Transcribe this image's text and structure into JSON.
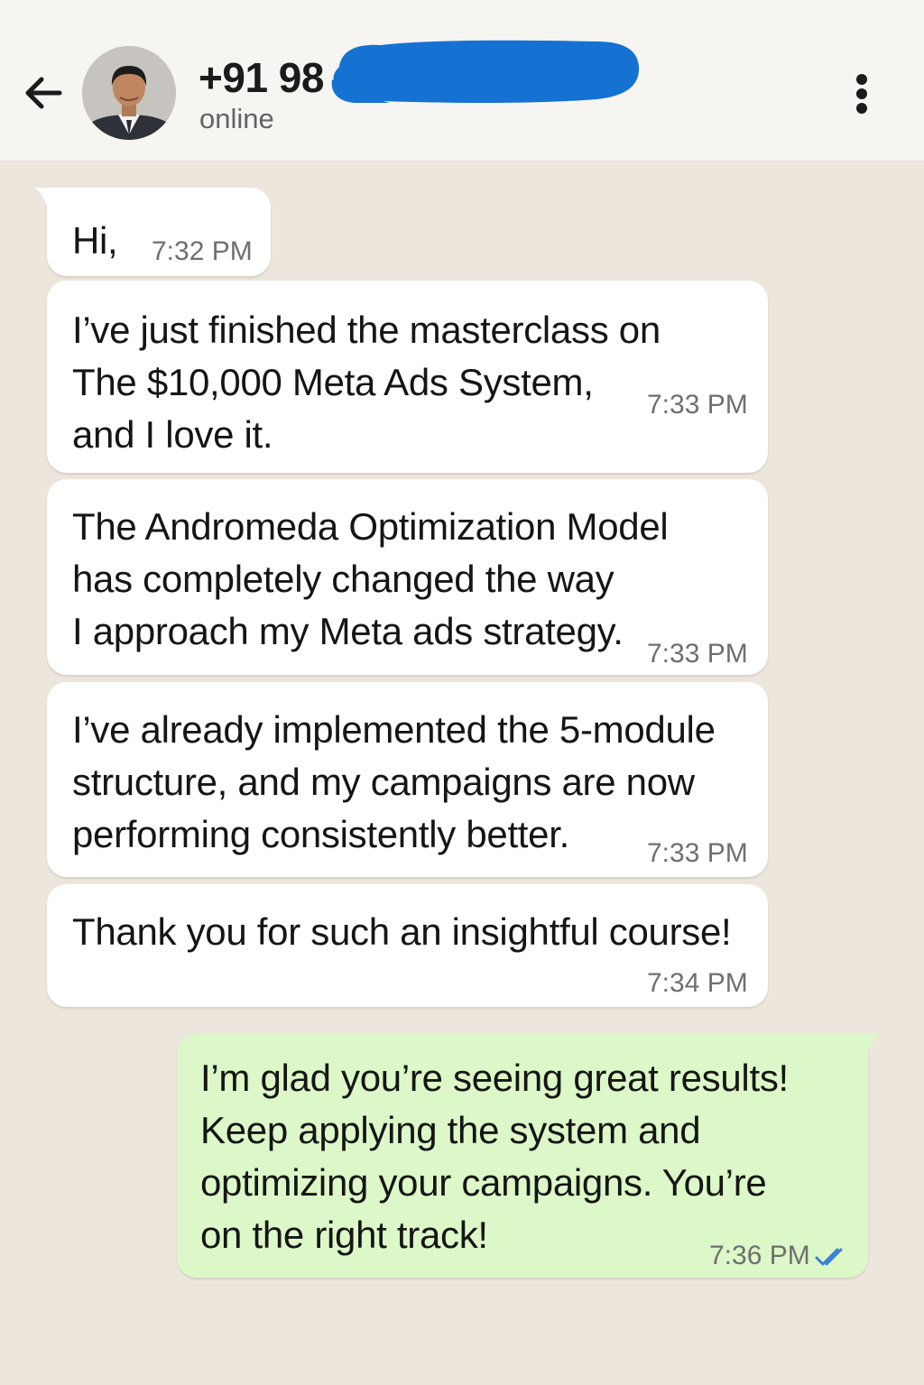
{
  "header": {
    "contact_name": "+91 98",
    "status": "online"
  },
  "messages": [
    {
      "direction": "incoming",
      "lines": "Hi,",
      "time": "7:32 PM"
    },
    {
      "direction": "incoming",
      "lines": "I’ve just finished the masterclass on\nThe $10,000 Meta Ads System,\nand I love it.",
      "time": "7:33 PM"
    },
    {
      "direction": "incoming",
      "lines": "The Andromeda Optimization Model\nhas completely changed the way\nI approach my Meta ads strategy.",
      "time": "7:33 PM"
    },
    {
      "direction": "incoming",
      "lines": "I’ve already implemented the 5-module\nstructure, and my campaigns are now\nperforming consistently better.",
      "time": "7:33 PM"
    },
    {
      "direction": "incoming",
      "lines": "Thank you for such an insightful course!",
      "time": "7:34 PM"
    },
    {
      "direction": "outgoing",
      "lines": "I’m glad you’re seeing great results!\nKeep applying the system and\noptimizing your campaigns. You’re\non the right track!",
      "time": "7:36 PM",
      "read_status": "double-check-read"
    }
  ],
  "colors": {
    "chat_background": "#ede6dd",
    "incoming_bubble": "#ffffff",
    "outgoing_bubble": "#ddf8c8",
    "read_tick": "#3b82d6",
    "redaction": "#1572d3"
  }
}
